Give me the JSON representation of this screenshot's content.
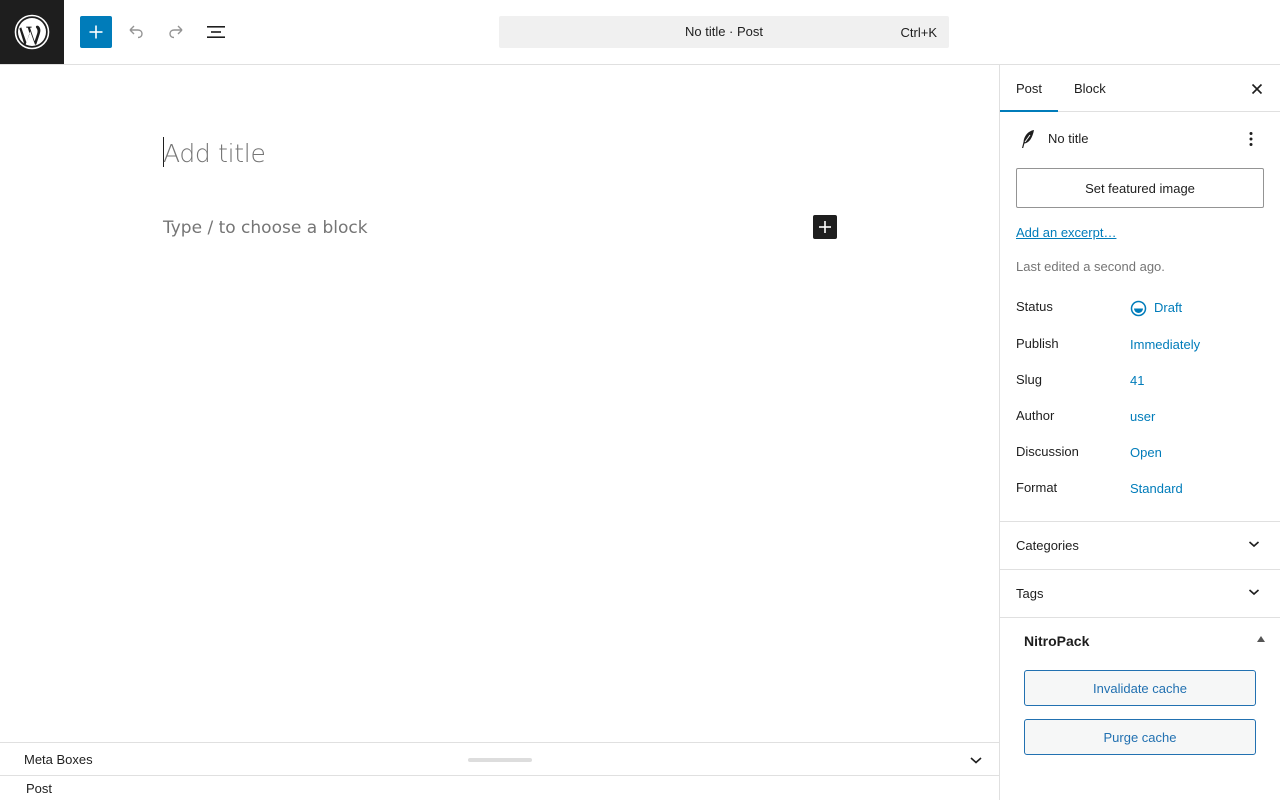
{
  "topbar": {
    "logo": "wordpress-logo",
    "add_block": "plus-icon",
    "undo": "undo-icon",
    "redo": "redo-icon",
    "document_overview": "list-view-icon",
    "command_title": "No title · Post",
    "command_shortcut": "Ctrl+K"
  },
  "canvas": {
    "title_placeholder": "Add title",
    "block_placeholder": "Type / to choose a block"
  },
  "metabox": {
    "label": "Meta Boxes",
    "footer_breadcrumb": "Post"
  },
  "sidebar": {
    "tabs": [
      {
        "label": "Post",
        "active": true
      },
      {
        "label": "Block",
        "active": false
      }
    ],
    "post_title": "No title",
    "featured_image_button": "Set featured image",
    "excerpt_link": "Add an excerpt…",
    "last_edited": "Last edited a second ago.",
    "rows": [
      {
        "label": "Status",
        "value": "Draft"
      },
      {
        "label": "Publish",
        "value": "Immediately"
      },
      {
        "label": "Slug",
        "value": "41"
      },
      {
        "label": "Author",
        "value": "user"
      },
      {
        "label": "Discussion",
        "value": "Open"
      },
      {
        "label": "Format",
        "value": "Standard"
      }
    ],
    "panels": [
      {
        "title": "Categories"
      },
      {
        "title": "Tags"
      }
    ],
    "nitropack": {
      "title": "NitroPack",
      "invalidate_button": "Invalidate cache",
      "purge_button": "Purge cache"
    }
  },
  "colors": {
    "accent": "#007cba",
    "dark": "#1e1e1e",
    "nitro_accent": "#2271b1"
  }
}
